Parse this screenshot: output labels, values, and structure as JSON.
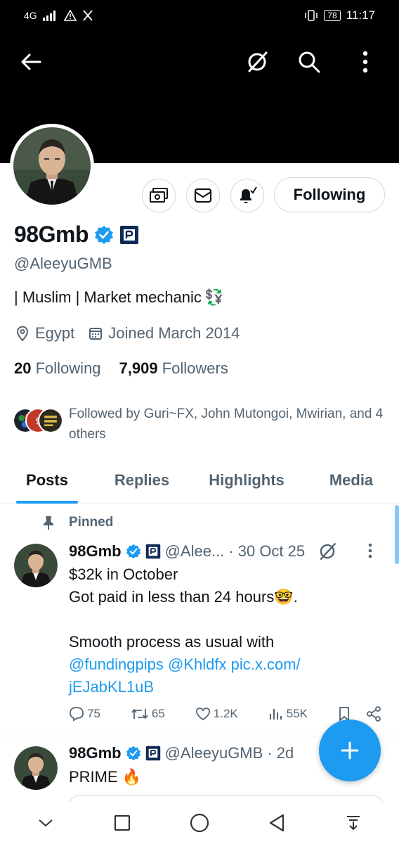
{
  "status_bar": {
    "network": "4G",
    "battery": "78",
    "time": "11:17"
  },
  "profile": {
    "display_name": "98Gmb",
    "handle": "@AleeyuGMB",
    "bio_text": "| Muslim |  Market mechanic",
    "bio_emoji": "💱",
    "location": "Egypt",
    "joined": "Joined March 2014",
    "following_count": "20",
    "following_label": "Following",
    "followers_count": "7,909",
    "followers_label": "Followers",
    "follow_button_label": "Following",
    "followed_by": "Followed by Guri~FX, John Mutongoi, Mwirian, and 4 others"
  },
  "tabs": [
    {
      "label": "Posts",
      "active": true
    },
    {
      "label": "Replies",
      "active": false
    },
    {
      "label": "Highlights",
      "active": false
    },
    {
      "label": "Media",
      "active": false
    }
  ],
  "pinned_tweet": {
    "pinned_label": "Pinned",
    "name": "98Gmb",
    "handle": "@Alee...",
    "date": "· 30 Oct 25",
    "line1": "$32k in October",
    "line2": "Got paid in less than 24 hours",
    "line2_emoji": "🤓",
    "line2_end": ".",
    "line3": "Smooth process as usual with",
    "mention1": "@fundingpips",
    "mention2": "@Khldfx",
    "link_part1": "pic.x.com/",
    "link_part2": "jEJabKL1uB",
    "replies": "75",
    "reposts": "65",
    "likes": "1.2K",
    "views": "55K"
  },
  "second_tweet": {
    "name": "98Gmb",
    "handle": "@AleeyuGMB",
    "date": "· 2d",
    "text": "PRIME",
    "emoji": "🔥"
  },
  "colors": {
    "accent": "#1d9bf0",
    "verified": "#1d9bf0",
    "text_primary": "#0f1419",
    "text_secondary": "#536471"
  },
  "icons": {
    "back": "arrow-left-icon",
    "grok": "grok-icon",
    "search": "search-icon",
    "more": "more-vertical-icon",
    "compose": "plus-icon"
  }
}
